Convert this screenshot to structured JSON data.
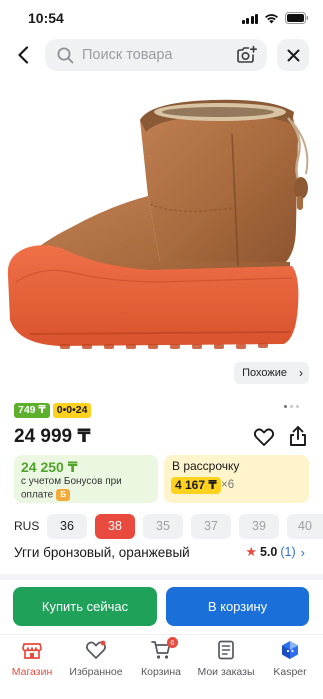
{
  "status_bar": {
    "time": "10:54"
  },
  "search": {
    "placeholder": "Поиск товара"
  },
  "gallery": {
    "similar_label": "Похожие",
    "dots_total": 3,
    "dots_active": 1
  },
  "badges": {
    "price_badge": "749 ₸",
    "installment_badge": "0•0•24"
  },
  "product": {
    "price": "24 999 ₸",
    "title": "Угги бронзовый, оранжевый",
    "rating": "5.0",
    "reviews": "(1)"
  },
  "bonus_card": {
    "amount": "24 250 ₸",
    "note": "с учетом Бонусов при оплате",
    "coin_icon": "bonus-coin-icon"
  },
  "installment_card": {
    "label": "В рассрочку",
    "amount": "4 167 ₸",
    "multiplier": "×6"
  },
  "sizes": {
    "system": "RUS",
    "options": [
      {
        "label": "36",
        "state": "available"
      },
      {
        "label": "38",
        "state": "selected"
      },
      {
        "label": "35",
        "state": "disabled"
      },
      {
        "label": "37",
        "state": "disabled"
      },
      {
        "label": "39",
        "state": "disabled"
      },
      {
        "label": "40",
        "state": "disabled"
      }
    ]
  },
  "actions": {
    "buy_now": "Купить сейчас",
    "add_to_cart": "В корзину"
  },
  "bottom_nav": {
    "items": [
      {
        "label": "Магазин",
        "icon": "shop-icon",
        "active": true
      },
      {
        "label": "Избранное",
        "icon": "heart-icon",
        "active": false
      },
      {
        "label": "Корзина",
        "icon": "cart-icon",
        "active": false,
        "badge": "6"
      },
      {
        "label": "Мои заказы",
        "icon": "orders-icon",
        "active": false
      },
      {
        "label": "Kasper",
        "icon": "kasper-icon",
        "active": false
      }
    ]
  },
  "colors": {
    "accent_red": "#e84a3d",
    "green_button": "#1fa15a",
    "blue_button": "#1a6fd8",
    "bonus_green": "#4ea52a",
    "installment_yellow": "#ffd21f"
  }
}
